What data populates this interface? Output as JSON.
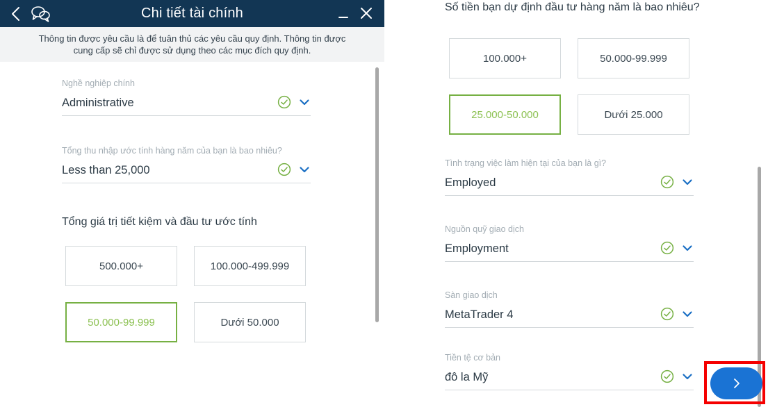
{
  "window": {
    "title": "Chi tiết tài chính",
    "back_icon": "back-chevron-icon",
    "chat_icon": "chat-bubbles-icon",
    "minimize_label": "_",
    "close_label": "✕",
    "header_color": "#123654"
  },
  "banner": {
    "text": "Thông tin được yêu cầu là để tuân thủ các yêu cầu quy định. Thông tin được cung cấp sẽ chỉ được sử dụng theo các mục đích quy định.",
    "background": "#f2f3f4"
  },
  "left": {
    "fields": [
      {
        "label": "Nghề nghiệp chính",
        "value": "Administrative"
      },
      {
        "label": "Tổng thu nhập ước tính hàng năm của bạn là bao nhiêu?",
        "value": "Less than 25,000"
      }
    ],
    "savings_heading": "Tổng giá trị tiết kiệm và đầu tư ước tính",
    "savings_options": [
      {
        "label": "500.000+",
        "selected": false
      },
      {
        "label": "100.000-499.999",
        "selected": false
      },
      {
        "label": "50.000-99.999",
        "selected": true
      },
      {
        "label": "Dưới 50.000",
        "selected": false
      }
    ]
  },
  "right": {
    "question": "Số tiền bạn dự định đầu tư hàng năm là bao nhiêu?",
    "investment_options": [
      {
        "label": "100.000+",
        "selected": false
      },
      {
        "label": "50.000-99.999",
        "selected": false
      },
      {
        "label": "25.000-50.000",
        "selected": true
      },
      {
        "label": "Dưới 25.000",
        "selected": false
      }
    ],
    "fields": [
      {
        "label": "Tình trạng việc làm hiện tại của bạn là gì?",
        "value": "Employed"
      },
      {
        "label": "Nguồn quỹ giao dịch",
        "value": "Employment"
      },
      {
        "label": "Sàn giao dịch",
        "value": "MetaTrader 4"
      },
      {
        "label": "Tiền tệ cơ bản",
        "value": "đô la Mỹ"
      }
    ]
  },
  "next_button": {
    "icon": "chevron-right-icon",
    "color": "#1a73d4",
    "annotation_color": "#f50000"
  },
  "colors": {
    "selected_border": "#76b043",
    "selected_text": "#8cc152",
    "check": "#76b043",
    "chevron": "#1a6fc4",
    "label": "#a2acb3",
    "underline": "#d4d9dc"
  }
}
